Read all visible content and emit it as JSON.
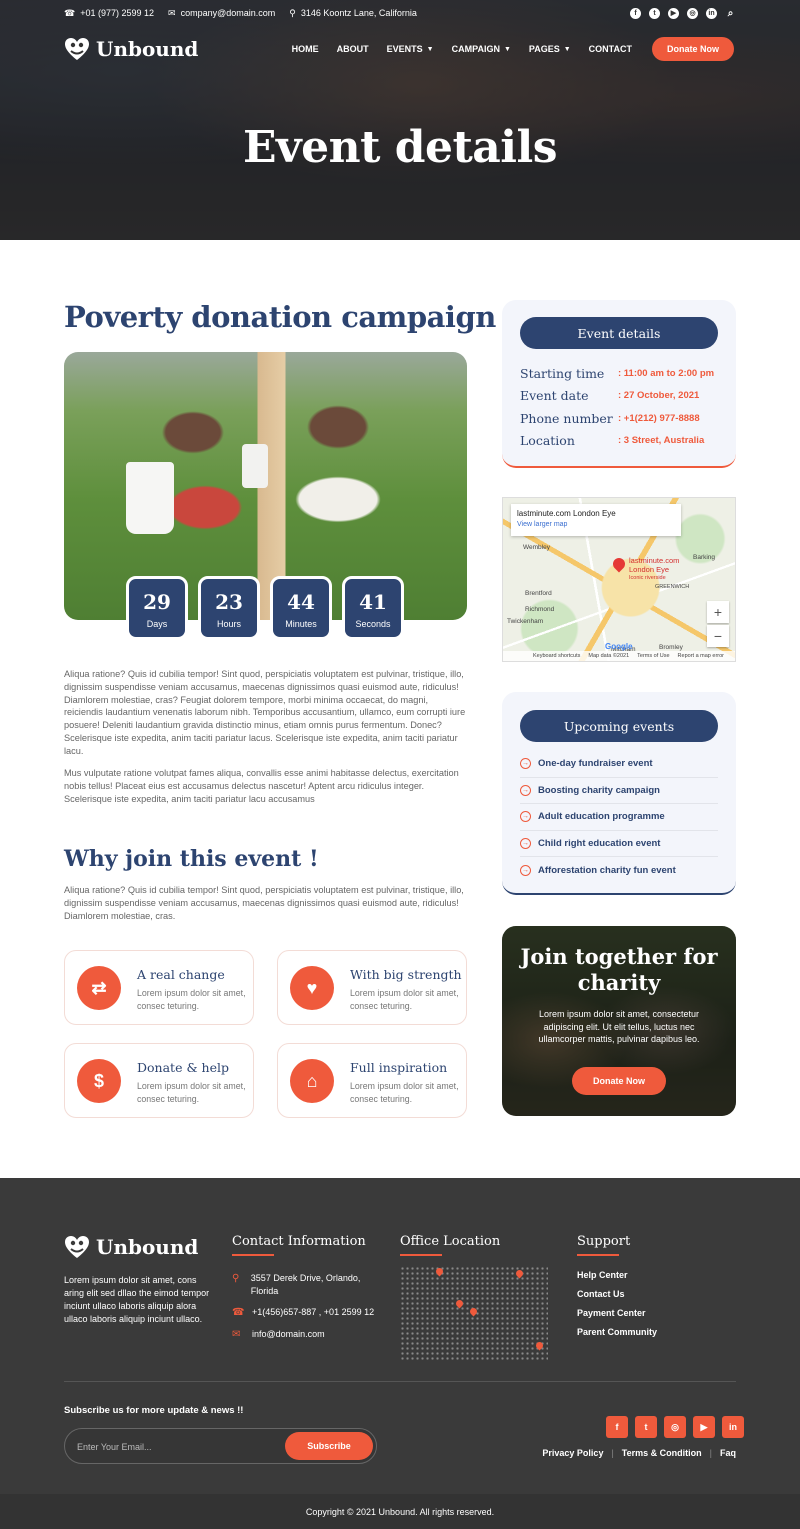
{
  "topbar": {
    "phone": "+01 (977) 2599 12",
    "email": "company@domain.com",
    "address": "3146 Koontz Lane, California",
    "social_icons": [
      "facebook-icon",
      "twitter-icon",
      "youtube-icon",
      "instagram-icon",
      "linkedin-icon",
      "search-icon"
    ]
  },
  "brand": {
    "name": "Unbound"
  },
  "nav": {
    "items": [
      "HOME",
      "ABOUT",
      "EVENTS",
      "CAMPAIGN",
      "PAGES",
      "CONTACT"
    ],
    "donate_label": "Donate Now"
  },
  "hero": {
    "title": "Event details"
  },
  "main": {
    "title": "Poverty donation campaign",
    "countdown": [
      {
        "value": "29",
        "label": "Days"
      },
      {
        "value": "23",
        "label": "Hours"
      },
      {
        "value": "44",
        "label": "Minutes"
      },
      {
        "value": "41",
        "label": "Seconds"
      }
    ],
    "paragraph1": "Aliqua ratione? Quis id cubilia tempor! Sint quod, perspiciatis voluptatem est pulvinar, tristique, illo, dignissim suspendisse veniam accusamus, maecenas dignissimos quasi euismod aute, ridiculus! Diamlorem molestiae, cras? Feugiat dolorem tempore, morbi minima occaecat, do magni, reiciendis laudantium venenatis laborum nibh. Temporibus accusantium, ullamco, eum corrupti iure posuere! Deleniti laudantium gravida distinctio minus, etiam omnis purus fermentum. Donec? Scelerisque iste expedita, anim taciti pariatur lacus. Scelerisque iste expedita, anim taciti pariatur lacu.",
    "paragraph2": "Mus vulputate ratione volutpat fames aliqua, convallis esse animi habitasse delectus, exercitation nobis tellus! Placeat eius est accusamus delectus nascetur! Aptent arcu ridiculus integer. Scelerisque iste expedita, anim taciti pariatur lacu accusamus",
    "why_title": "Why join this event !",
    "why_paragraph": "Aliqua ratione? Quis id cubilia tempor! Sint quod, perspiciatis voluptatem est pulvinar, tristique, illo, dignissim suspendisse veniam accusamus, maecenas dignissimos quasi euismod aute, ridiculus! Diamlorem molestiae, cras.",
    "features": [
      {
        "title": "A real change",
        "desc": "Lorem ipsum dolor sit amet, consec teturing.",
        "icon": "exchange-icon"
      },
      {
        "title": "With big strength",
        "desc": "Lorem ipsum dolor sit amet, consec teturing.",
        "icon": "heart-hand-icon"
      },
      {
        "title": "Donate & help",
        "desc": "Lorem ipsum dolor sit amet, consec teturing.",
        "icon": "donate-icon"
      },
      {
        "title": "Full inspiration",
        "desc": "Lorem ipsum dolor sit amet, consec teturing.",
        "icon": "home-heart-icon"
      }
    ]
  },
  "sidebar": {
    "details_title": "Event details",
    "details": [
      {
        "key": "Starting time",
        "value": ": 11:00 am to 2:00 pm"
      },
      {
        "key": "Event date",
        "value": ": 27 October, 2021"
      },
      {
        "key": "Phone number",
        "value": ": +1(212) 977-8888"
      },
      {
        "key": "Location",
        "value": ": 3 Street, Australia"
      }
    ],
    "map": {
      "place_title": "lastminute.com London Eye",
      "view_larger": "View larger map",
      "pin_label_1": "lastminute.com",
      "pin_label_2": "London Eye",
      "pin_label_3": "Iconic riverside",
      "places": [
        "Wembley",
        "Brentford",
        "Richmond",
        "Twickenham",
        "Mitcham",
        "Bromley",
        "Barking",
        "GREENWICH"
      ],
      "footer": [
        "Keyboard shortcuts",
        "Map data ©2021",
        "Terms of Use",
        "Report a map error"
      ],
      "google": "Google"
    },
    "upcoming_title": "Upcoming events",
    "upcoming": [
      "One-day fundraiser event",
      "Boosting charity campaign",
      "Adult education programme",
      "Child right education event",
      "Afforestation charity fun event"
    ],
    "join": {
      "title": "Join together for charity",
      "desc": "Lorem ipsum dolor sit amet, consectetur adipiscing elit. Ut elit tellus, luctus nec ullamcorper mattis, pulvinar dapibus leo.",
      "button": "Donate Now"
    }
  },
  "footer": {
    "desc": "Lorem ipsum dolor sit amet, cons aring elit sed dllao the eimod tempor inciunt ullaco laboris aliquip alora ullaco laboris aliquip inciunt ullaco.",
    "contact_title": "Contact Information",
    "address": "3557 Derek Drive, Orlando, Florida",
    "phones": "+1(456)657-887 , +01 2599 12",
    "email": "info@domain.com",
    "office_title": "Office Location",
    "support_title": "Support",
    "support_links": [
      "Help Center",
      "Contact Us",
      "Payment Center",
      "Parent Community"
    ],
    "subscribe_title": "Subscribe us for more update & news !!",
    "email_placeholder": "Enter Your Email...",
    "subscribe_button": "Subscribe",
    "social_icons": [
      "facebook-icon",
      "twitter-icon",
      "instagram-icon",
      "youtube-icon",
      "linkedin-icon"
    ],
    "legal": [
      "Privacy Policy",
      "Terms & Condition",
      "Faq"
    ],
    "copyright": "Copyright © 2021 Unbound. All rights reserved."
  },
  "colors": {
    "accent": "#ef5a3c",
    "navy": "#2d4470",
    "footer_bg": "#3a3a3a"
  }
}
